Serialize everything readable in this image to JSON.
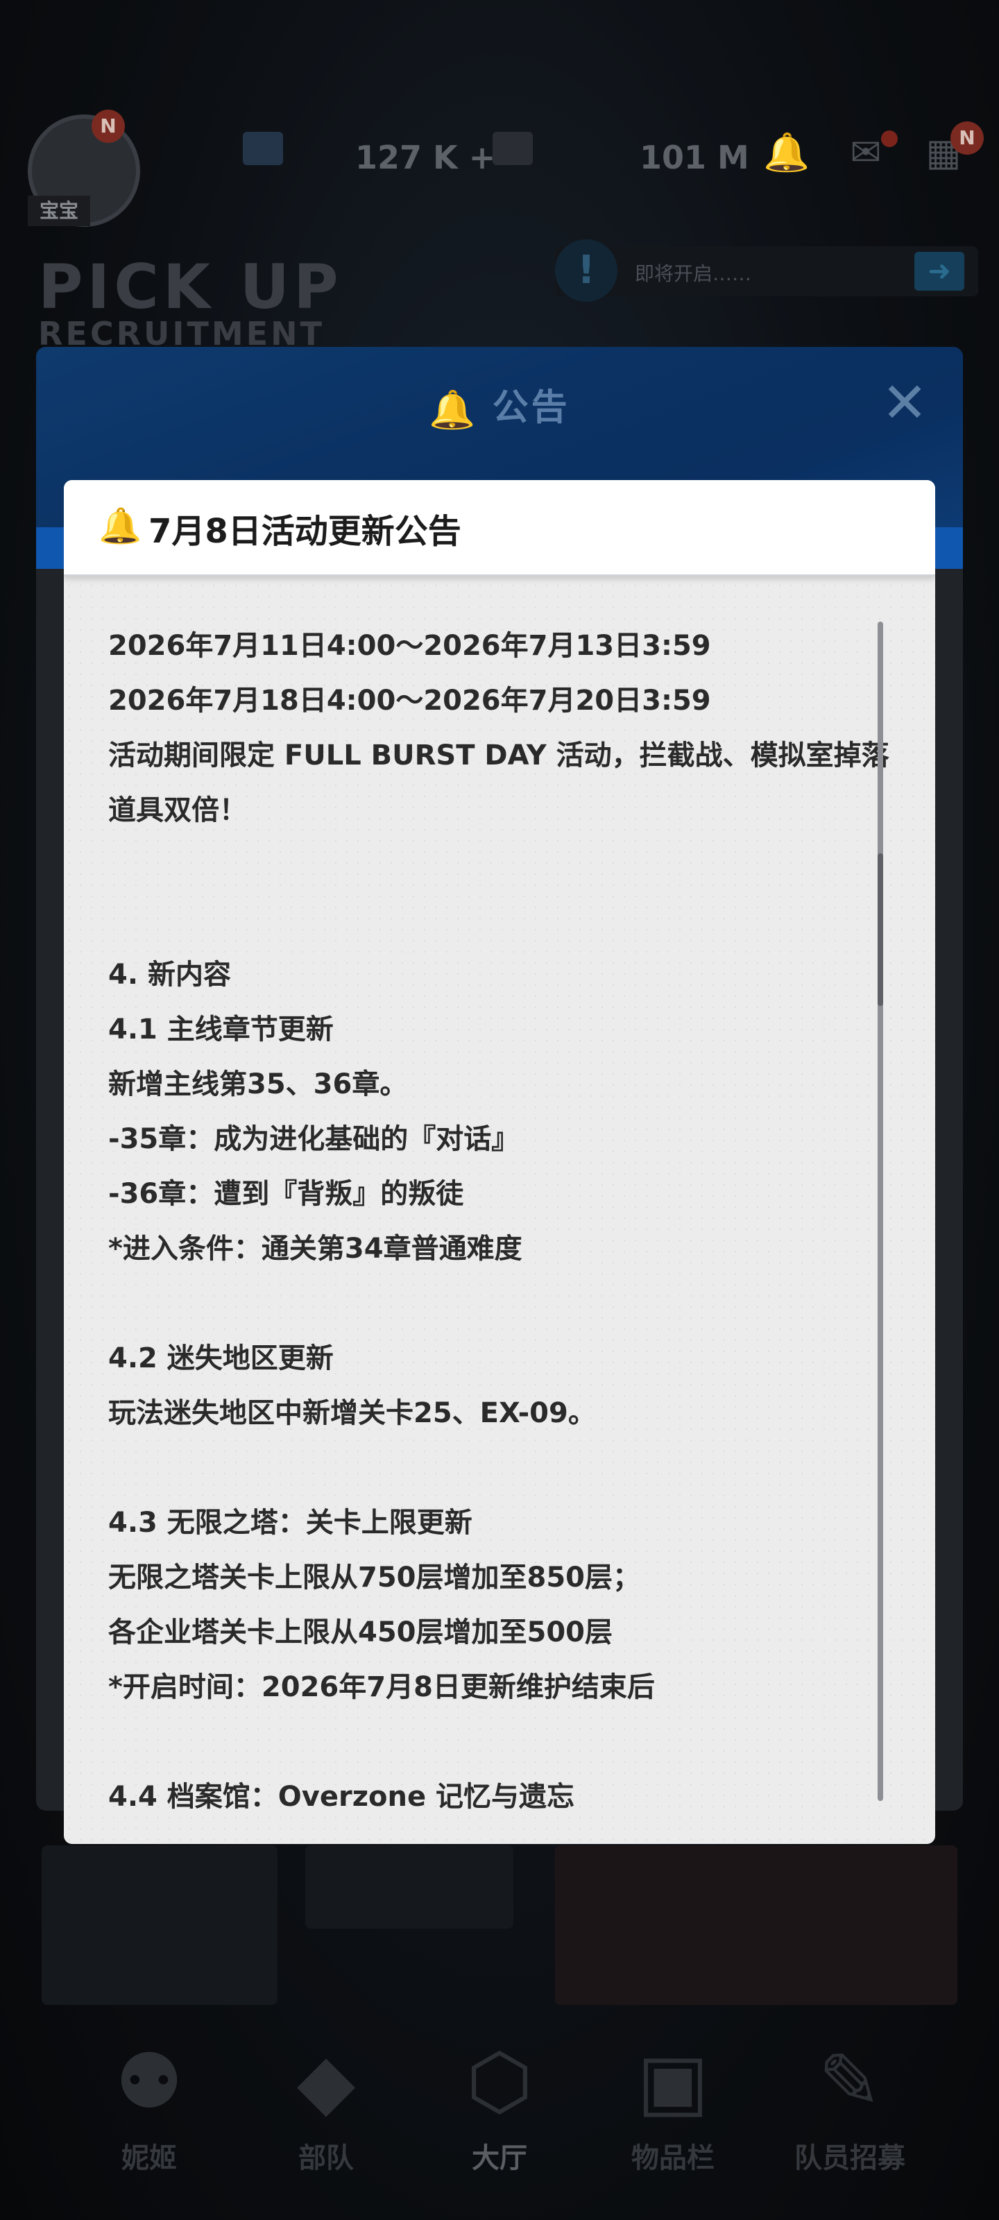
{
  "background": {
    "player_name": "宝宝",
    "badge": "N",
    "resource_1": "127 K +",
    "resource_2": "101 M",
    "pickup_line1": "PICK UP",
    "pickup_line2": "RECRUITMENT",
    "notice_text": "即将开启……",
    "nav": [
      {
        "label": "妮姬",
        "icon": "people-icon"
      },
      {
        "label": "部队",
        "icon": "squad-icon"
      },
      {
        "label": "大厅",
        "icon": "lobby-icon"
      },
      {
        "label": "物品栏",
        "icon": "inventory-icon"
      },
      {
        "label": "队员招募",
        "icon": "recruit-icon"
      }
    ]
  },
  "modal": {
    "title": "公告",
    "close_icon": "close-icon"
  },
  "announcement": {
    "title": "7月8日活动更新公告",
    "lines": [
      "2026年7月11日4:00～2026年7月13日3:59",
      "2026年7月18日4:00～2026年7月20日3:59",
      "活动期间限定 FULL BURST DAY 活动，拦截战、模拟室掉落道具双倍！",
      "",
      "",
      "4. 新内容",
      "4.1 主线章节更新",
      "新增主线第35、36章。",
      "-35章：成为进化基础的『对话』",
      "-36章：遭到『背叛』的叛徒",
      "*进入条件：通关第34章普通难度",
      "",
      "4.2 迷失地区更新",
      "玩法迷失地区中新增关卡25、EX-09。",
      "",
      "4.3 无限之塔：关卡上限更新",
      "无限之塔关卡上限从750层增加至850层；",
      "各企业塔关卡上限从450层增加至500层",
      "*开启时间：2026年7月8日更新维护结束后",
      "",
      "4.4 档案馆：Overzone  记忆与遗忘"
    ]
  }
}
